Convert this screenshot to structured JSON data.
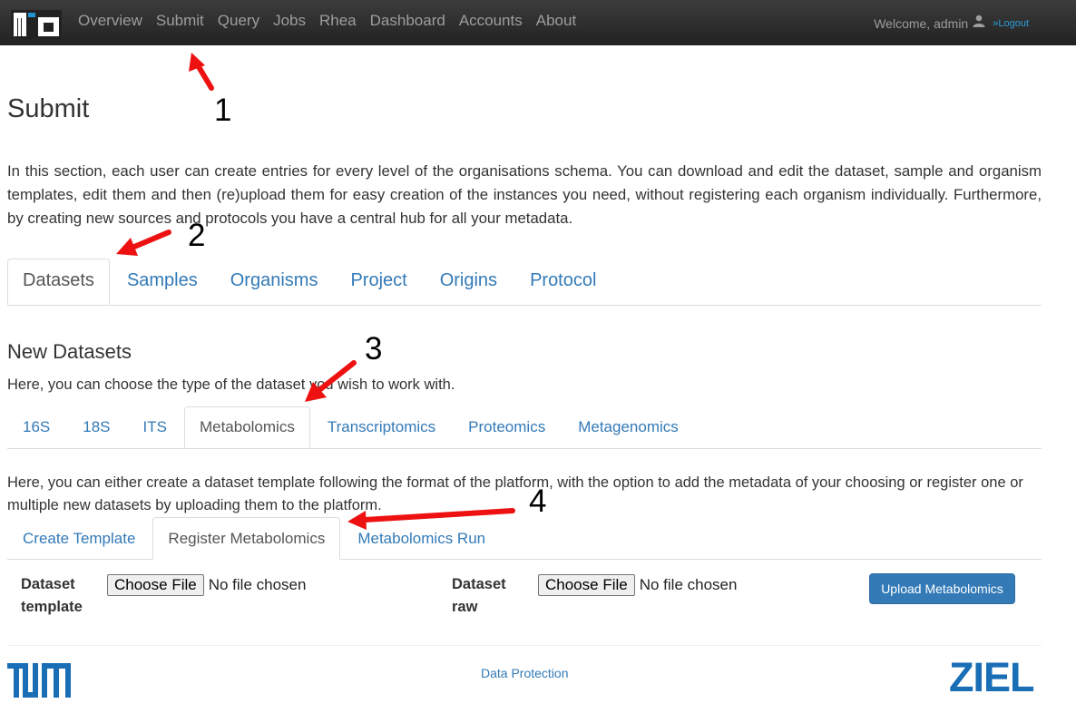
{
  "navbar": {
    "links": [
      "Overview",
      "Submit",
      "Query",
      "Jobs",
      "Rhea",
      "Dashboard",
      "Accounts",
      "About"
    ],
    "welcome": "Welcome, admin",
    "logout": "»Logout"
  },
  "page": {
    "title": "Submit",
    "intro": "In this section, each user can create entries for every level of the organisations schema. You can download and edit the dataset, sample and organism templates, edit them and then (re)upload them for easy creation of the instances you need, without registering each organism individually. Furthermore, by creating new sources and protocols you have a central hub for all your metadata."
  },
  "main_tabs": [
    "Datasets",
    "Samples",
    "Organisms",
    "Project",
    "Origins",
    "Protocol"
  ],
  "new_datasets": {
    "title": "New Datasets",
    "description": "Here, you can choose the type of the dataset you wish to work with.",
    "tabs": [
      "16S",
      "18S",
      "ITS",
      "Metabolomics",
      "Transcriptomics",
      "Proteomics",
      "Metagenomics"
    ]
  },
  "metabolomics": {
    "description": "Here, you can either create a dataset template following the format of the platform, with the option to add the metadata of your choosing or register one or multiple new datasets by uploading them to the platform.",
    "tabs": [
      "Create Template",
      "Register Metabolomics",
      "Metabolomics Run"
    ],
    "form": {
      "template_label_1": "Dataset",
      "template_label_2": "template",
      "raw_label_1": "Dataset",
      "raw_label_2": "raw",
      "choose_file": "Choose File",
      "no_file": "No file chosen",
      "upload_button": "Upload Metabolomics"
    }
  },
  "footer": {
    "data_protection": "Data Protection",
    "ziel_logo_text": "ZIEL"
  },
  "annotations": [
    "1",
    "2",
    "3",
    "4"
  ],
  "colors": {
    "navbar": "#222222",
    "link": "#337ab7",
    "primary_button": "#337ab7",
    "annotation_arrow": "#ee1111"
  }
}
